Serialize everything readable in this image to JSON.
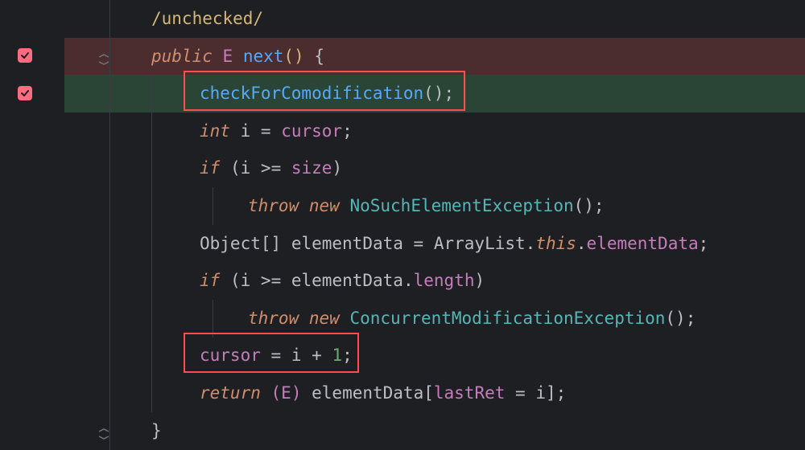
{
  "colors": {
    "bg": "#1e1f22",
    "rowRed": "#4b2d2f",
    "rowGreen": "#2a4436",
    "redBox": "#ff4d4f",
    "checkbox": "#ff6b81"
  },
  "layout": {
    "lineHeight": 46.6,
    "indentLevels": [
      56,
      106,
      170,
      182
    ]
  },
  "gutter": {
    "checkboxes": [
      {
        "line": 1,
        "checked": true
      },
      {
        "line": 2,
        "checked": true
      }
    ],
    "foldMarkers": [
      {
        "line": 1,
        "kind": "start"
      },
      {
        "line": 11,
        "kind": "end"
      }
    ]
  },
  "highlights": {
    "red": {
      "line": 1
    },
    "green": {
      "line": 2
    },
    "boxes": [
      {
        "id": "box1",
        "around": "checkForComodification();"
      },
      {
        "id": "box2",
        "around": "cursor = i + 1;"
      }
    ]
  },
  "code": {
    "language": "java",
    "lines": [
      {
        "indent": 2,
        "raw": "/unchecked/",
        "tokens": [
          {
            "cls": "comment",
            "t": "/unchecked/"
          }
        ]
      },
      {
        "indent": 2,
        "raw": "public E next() {",
        "tokens": [
          {
            "cls": "kw-italic",
            "t": "public"
          },
          {
            "cls": "",
            "t": " "
          },
          {
            "cls": "cls",
            "t": "E"
          },
          {
            "cls": "",
            "t": " "
          },
          {
            "cls": "method",
            "t": "next"
          },
          {
            "cls": "paren-yellow",
            "t": "()"
          },
          {
            "cls": "",
            "t": " "
          },
          {
            "cls": "brace",
            "t": "{"
          }
        ]
      },
      {
        "indent": 3,
        "raw": "checkForComodification();",
        "tokens": [
          {
            "cls": "mcall",
            "t": "checkForComodification"
          },
          {
            "cls": "punct",
            "t": "()"
          },
          {
            "cls": "punct",
            "t": ";"
          }
        ]
      },
      {
        "indent": 3,
        "raw": "int i = cursor;",
        "tokens": [
          {
            "cls": "kw-italic",
            "t": "int"
          },
          {
            "cls": "",
            "t": " "
          },
          {
            "cls": "ident",
            "t": "i"
          },
          {
            "cls": "",
            "t": " "
          },
          {
            "cls": "eq",
            "t": "="
          },
          {
            "cls": "",
            "t": " "
          },
          {
            "cls": "field",
            "t": "cursor"
          },
          {
            "cls": "punct",
            "t": ";"
          }
        ]
      },
      {
        "indent": 3,
        "raw": "if (i >= size)",
        "tokens": [
          {
            "cls": "kw-italic",
            "t": "if"
          },
          {
            "cls": "",
            "t": " "
          },
          {
            "cls": "punct",
            "t": "("
          },
          {
            "cls": "ident",
            "t": "i"
          },
          {
            "cls": "",
            "t": " "
          },
          {
            "cls": "punct",
            "t": ">="
          },
          {
            "cls": "",
            "t": " "
          },
          {
            "cls": "field",
            "t": "size"
          },
          {
            "cls": "punct",
            "t": ")"
          }
        ]
      },
      {
        "indent": 4,
        "raw": "throw new NoSuchElementException();",
        "tokens": [
          {
            "cls": "kw-italic",
            "t": "throw"
          },
          {
            "cls": "",
            "t": " "
          },
          {
            "cls": "kw-italic",
            "t": "new"
          },
          {
            "cls": "",
            "t": " "
          },
          {
            "cls": "clsTeal",
            "t": "NoSuchElementException"
          },
          {
            "cls": "punct",
            "t": "()"
          },
          {
            "cls": "punct",
            "t": ";"
          }
        ]
      },
      {
        "indent": 3,
        "raw": "Object[] elementData = ArrayList.this.elementData;",
        "tokens": [
          {
            "cls": "type",
            "t": "Object"
          },
          {
            "cls": "punct",
            "t": "[]"
          },
          {
            "cls": "",
            "t": " "
          },
          {
            "cls": "ident",
            "t": "elementData"
          },
          {
            "cls": "",
            "t": " "
          },
          {
            "cls": "eq",
            "t": "="
          },
          {
            "cls": "",
            "t": " "
          },
          {
            "cls": "ident",
            "t": "ArrayList"
          },
          {
            "cls": "punct",
            "t": "."
          },
          {
            "cls": "thiskw",
            "t": "this"
          },
          {
            "cls": "punct",
            "t": "."
          },
          {
            "cls": "field",
            "t": "elementData"
          },
          {
            "cls": "punct",
            "t": ";"
          }
        ]
      },
      {
        "indent": 3,
        "raw": "if (i >= elementData.length)",
        "tokens": [
          {
            "cls": "kw-italic",
            "t": "if"
          },
          {
            "cls": "",
            "t": " "
          },
          {
            "cls": "punct",
            "t": "("
          },
          {
            "cls": "ident",
            "t": "i"
          },
          {
            "cls": "",
            "t": " "
          },
          {
            "cls": "punct",
            "t": ">="
          },
          {
            "cls": "",
            "t": " "
          },
          {
            "cls": "ident",
            "t": "elementData"
          },
          {
            "cls": "punct",
            "t": "."
          },
          {
            "cls": "field",
            "t": "length"
          },
          {
            "cls": "punct",
            "t": ")"
          }
        ]
      },
      {
        "indent": 4,
        "raw": "throw new ConcurrentModificationException();",
        "tokens": [
          {
            "cls": "kw-italic",
            "t": "throw"
          },
          {
            "cls": "",
            "t": " "
          },
          {
            "cls": "kw-italic",
            "t": "new"
          },
          {
            "cls": "",
            "t": " "
          },
          {
            "cls": "clsTeal",
            "t": "ConcurrentModificationException"
          },
          {
            "cls": "punct",
            "t": "()"
          },
          {
            "cls": "punct",
            "t": ";"
          }
        ]
      },
      {
        "indent": 3,
        "raw": "cursor = i + 1;",
        "tokens": [
          {
            "cls": "field",
            "t": "cursor"
          },
          {
            "cls": "",
            "t": " "
          },
          {
            "cls": "eq",
            "t": "="
          },
          {
            "cls": "",
            "t": " "
          },
          {
            "cls": "ident",
            "t": "i"
          },
          {
            "cls": "",
            "t": " "
          },
          {
            "cls": "punct",
            "t": "+"
          },
          {
            "cls": "",
            "t": " "
          },
          {
            "cls": "num",
            "t": "1"
          },
          {
            "cls": "punct",
            "t": ";"
          }
        ]
      },
      {
        "indent": 3,
        "raw": "return (E) elementData[lastRet = i];",
        "tokens": [
          {
            "cls": "kw-italic",
            "t": "return"
          },
          {
            "cls": "",
            "t": " "
          },
          {
            "cls": "parenP",
            "t": "("
          },
          {
            "cls": "cls",
            "t": "E"
          },
          {
            "cls": "parenP",
            "t": ")"
          },
          {
            "cls": "",
            "t": " "
          },
          {
            "cls": "ident",
            "t": "elementData"
          },
          {
            "cls": "punct",
            "t": "["
          },
          {
            "cls": "field",
            "t": "lastRet"
          },
          {
            "cls": "",
            "t": " "
          },
          {
            "cls": "eq",
            "t": "="
          },
          {
            "cls": "",
            "t": " "
          },
          {
            "cls": "ident",
            "t": "i"
          },
          {
            "cls": "punct",
            "t": "]"
          },
          {
            "cls": "punct",
            "t": ";"
          }
        ]
      },
      {
        "indent": 2,
        "raw": "}",
        "tokens": [
          {
            "cls": "brace",
            "t": "}"
          }
        ]
      }
    ]
  }
}
